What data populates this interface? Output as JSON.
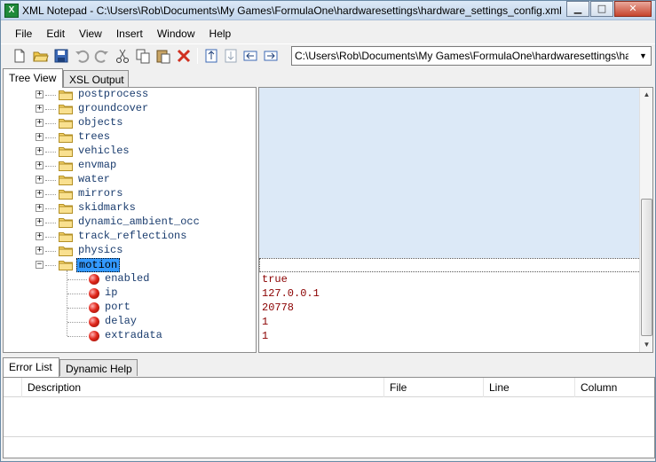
{
  "window": {
    "title": "XML Notepad - C:\\Users\\Rob\\Documents\\My Games\\FormulaOne\\hardwaresettings\\hardware_settings_config.xml",
    "buttons": [
      "minimize",
      "maximize",
      "close"
    ]
  },
  "menu": [
    "File",
    "Edit",
    "View",
    "Insert",
    "Window",
    "Help"
  ],
  "toolbar": {
    "icons": [
      "new-file-icon",
      "open-folder-icon",
      "save-icon",
      "undo-icon",
      "redo-icon",
      "cut-icon",
      "copy-icon",
      "paste-icon",
      "delete-icon",
      "nudge-up-icon",
      "nudge-down-icon",
      "nudge-left-icon",
      "nudge-right-icon"
    ],
    "path": "C:\\Users\\Rob\\Documents\\My Games\\FormulaOne\\hardwaresettings\\ha"
  },
  "tabs_top": [
    "Tree View",
    "XSL Output"
  ],
  "tree": {
    "folders": [
      "postprocess",
      "groundcover",
      "objects",
      "trees",
      "vehicles",
      "envmap",
      "water",
      "mirrors",
      "skidmarks",
      "dynamic_ambient_occ",
      "track_reflections",
      "physics"
    ],
    "selected": "motion",
    "attributes": [
      {
        "name": "enabled",
        "value": "true"
      },
      {
        "name": "ip",
        "value": "127.0.0.1"
      },
      {
        "name": "port",
        "value": "20778"
      },
      {
        "name": "delay",
        "value": "1"
      },
      {
        "name": "extradata",
        "value": "1"
      }
    ]
  },
  "tabs_bottom": [
    "Error List",
    "Dynamic Help"
  ],
  "error_list": {
    "columns": [
      "Description",
      "File",
      "Line",
      "Column"
    ]
  },
  "colors": {
    "selection": "#3399ff",
    "value_text": "#8b0000",
    "node_text": "#1a3c6e",
    "value_bg": "#dce9f7"
  }
}
